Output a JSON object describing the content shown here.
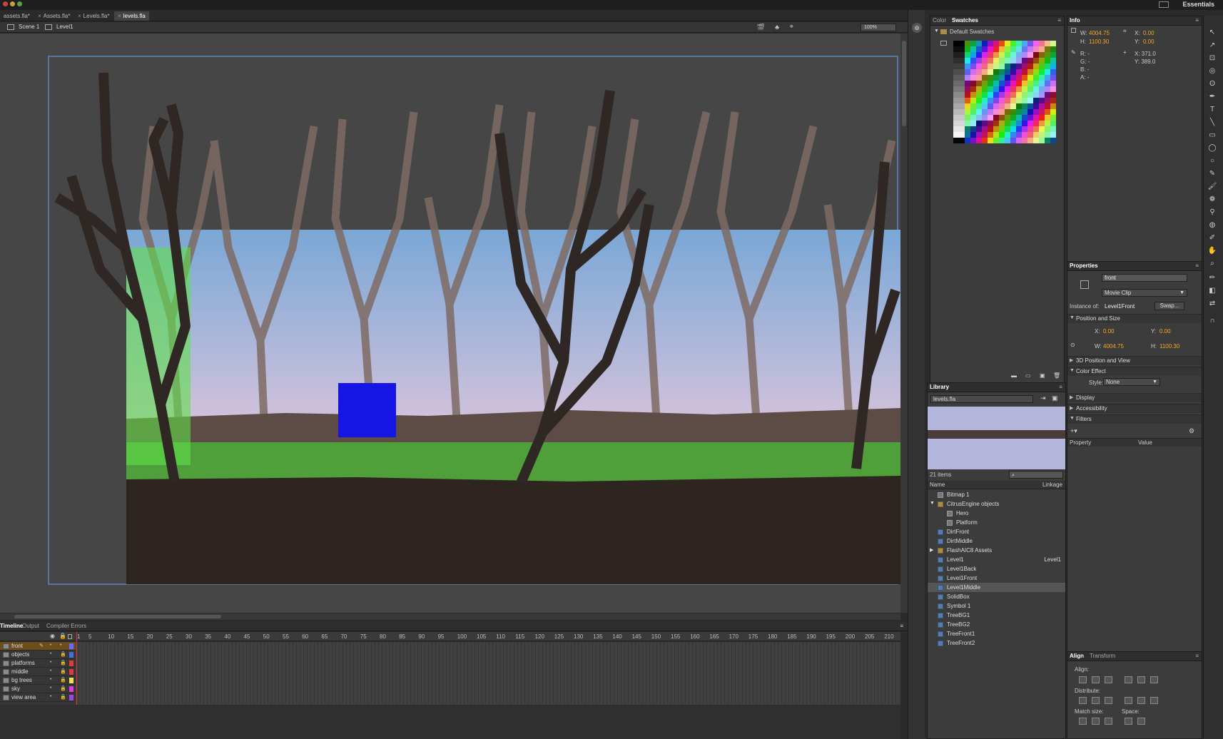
{
  "workspace": "Essentials",
  "doc_tabs": [
    {
      "label": "assets.fla*"
    },
    {
      "label": "Assets.fla*"
    },
    {
      "label": "Levels.fla*"
    },
    {
      "label": "levels.fla"
    }
  ],
  "edit_bar": {
    "scene": "Scene 1",
    "symbol": "Level1",
    "zoom": "100%"
  },
  "timeline": {
    "tabs": [
      "Timeline",
      "Output",
      "Compiler Errors"
    ],
    "frame_numbers": [
      "1",
      "5",
      "10",
      "15",
      "20",
      "25",
      "30",
      "35",
      "40",
      "45",
      "50",
      "55",
      "60",
      "65",
      "70",
      "75",
      "80",
      "85",
      "90",
      "95",
      "100",
      "105",
      "110",
      "115",
      "120",
      "125",
      "130",
      "135",
      "140",
      "145",
      "150",
      "155",
      "160",
      "165",
      "170",
      "175",
      "180",
      "185",
      "190",
      "195",
      "200",
      "205",
      "210"
    ],
    "layers": [
      {
        "name": "front",
        "color": "#6b6bff"
      },
      {
        "name": "objects",
        "color": "#4a6bd9"
      },
      {
        "name": "platforms",
        "color": "#e03a3a"
      },
      {
        "name": "middle",
        "color": "#e03a3a"
      },
      {
        "name": "bg trees",
        "color": "#f0e24a"
      },
      {
        "name": "sky",
        "color": "#e03ae0"
      },
      {
        "name": "view area",
        "color": "#9a4ae0"
      }
    ]
  },
  "swatches_panel": {
    "tabs": [
      "Color",
      "Swatches"
    ],
    "folder": "Default Swatches"
  },
  "info_panel": {
    "title": "Info",
    "w_label": "W:",
    "w": "4004.75",
    "h_label": "H:",
    "h": "1100.30",
    "x_label": "X:",
    "x": "0.00",
    "y_label": "Y:",
    "y": "0.00",
    "r": "R: -",
    "g": "G: -",
    "b": "B: -",
    "a": "A: -",
    "mouse_x": "X: 371.0",
    "mouse_y": "Y: 389.0"
  },
  "library": {
    "title": "Library",
    "file": "levels.fla",
    "count": "21 items",
    "col_name": "Name",
    "col_linkage": "Linkage",
    "items": [
      {
        "name": "Bitmap 1",
        "kind": "bitmap",
        "linkage": ""
      },
      {
        "name": "CitrusEngine objects",
        "kind": "folder-open",
        "linkage": ""
      },
      {
        "name": "Hero",
        "kind": "component",
        "linkage": ""
      },
      {
        "name": "Platform",
        "kind": "component",
        "linkage": ""
      },
      {
        "name": "DirtFront",
        "kind": "symbol",
        "linkage": ""
      },
      {
        "name": "DirtMiddle",
        "kind": "symbol",
        "linkage": ""
      },
      {
        "name": "FlashAIC8 Assets",
        "kind": "folder",
        "linkage": ""
      },
      {
        "name": "Level1",
        "kind": "symbol",
        "linkage": "Level1"
      },
      {
        "name": "Level1Back",
        "kind": "symbol",
        "linkage": ""
      },
      {
        "name": "Level1Front",
        "kind": "symbol",
        "linkage": ""
      },
      {
        "name": "Level1Middle",
        "kind": "symbol",
        "linkage": ""
      },
      {
        "name": "SolidBox",
        "kind": "symbol",
        "linkage": ""
      },
      {
        "name": "Symbol 1",
        "kind": "symbol",
        "linkage": ""
      },
      {
        "name": "TreeBG1",
        "kind": "symbol",
        "linkage": ""
      },
      {
        "name": "TreeBG2",
        "kind": "symbol",
        "linkage": ""
      },
      {
        "name": "TreeFront1",
        "kind": "symbol",
        "linkage": ""
      },
      {
        "name": "TreeFront2",
        "kind": "symbol",
        "linkage": ""
      }
    ]
  },
  "properties": {
    "title": "Properties",
    "instance_name": "front",
    "type": "Movie Clip",
    "instance_of_label": "Instance of:",
    "instance_of": "Level1Front",
    "swap": "Swap...",
    "sec_position": "Position and Size",
    "x_label": "X:",
    "x": "0.00",
    "y_label": "Y:",
    "y": "0.00",
    "w_label": "W:",
    "w": "4004.75",
    "h_label": "H:",
    "h": "1100.30",
    "sec_3d": "3D Position and View",
    "sec_color": "Color Effect",
    "style_label": "Style:",
    "style": "None",
    "sec_display": "Display",
    "sec_access": "Accessibility",
    "sec_filters": "Filters",
    "col_property": "Property",
    "col_value": "Value"
  },
  "align_panel": {
    "tabs": [
      "Align",
      "Transform"
    ],
    "align": "Align:",
    "distribute": "Distribute:",
    "match": "Match size:",
    "space": "Space:"
  },
  "colors": {
    "accent": "#f5a623",
    "panel": "#3c3c3c",
    "blue_box": "#1515e6",
    "grass": "#4fa03b",
    "dirt": "#2e2420"
  }
}
